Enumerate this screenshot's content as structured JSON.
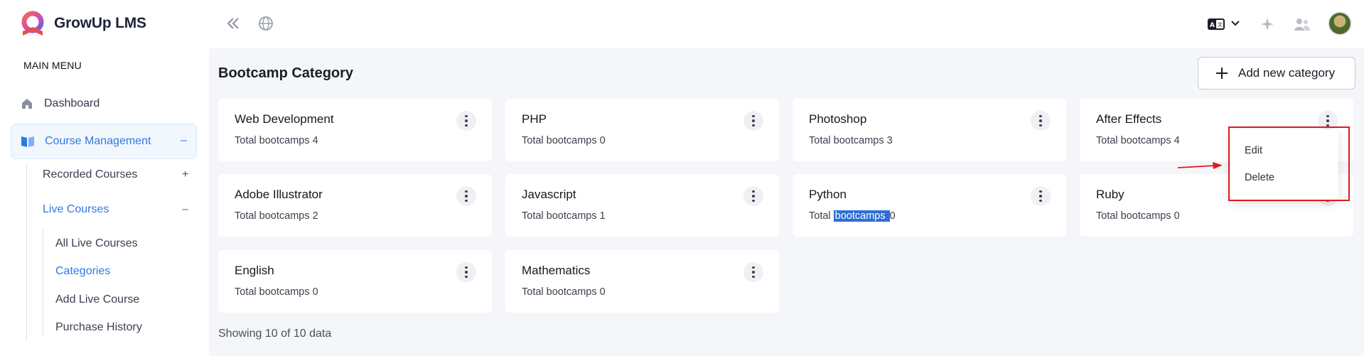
{
  "app": {
    "name": "GrowUp LMS"
  },
  "sidebar": {
    "menu_label": "MAIN MENU",
    "dashboard": "Dashboard",
    "course_management": "Course Management",
    "course_management_sign": "–",
    "recorded_courses": "Recorded Courses",
    "recorded_sign": "+",
    "live_courses": "Live Courses",
    "live_sign": "–",
    "live_items": [
      "All Live Courses",
      "Categories",
      "Add Live Course",
      "Purchase History"
    ]
  },
  "topbar": {
    "icons": [
      "collapse-icon",
      "globe-icon",
      "language-icon",
      "chevron-down-icon",
      "sparkle-icon",
      "users-icon",
      "avatar"
    ]
  },
  "page": {
    "title": "Bootcamp Category",
    "add_button": "Add new category",
    "footer": "Showing 10 of 10 data"
  },
  "categories": [
    {
      "name": "Web Development",
      "count_label": "Total bootcamps 4"
    },
    {
      "name": "PHP",
      "count_label": "Total bootcamps 0"
    },
    {
      "name": "Photoshop",
      "count_label": "Total bootcamps 3"
    },
    {
      "name": "After Effects",
      "count_label": "Total bootcamps 4"
    },
    {
      "name": "Adobe Illustrator",
      "count_label": "Total bootcamps 2"
    },
    {
      "name": "Javascript",
      "count_label": "Total bootcamps 1"
    },
    {
      "name": "Python",
      "count_prefix": "Total ",
      "count_highlight": "bootcamps ",
      "count_suffix": "0"
    },
    {
      "name": "Ruby",
      "count_label": "Total bootcamps 0"
    },
    {
      "name": "English",
      "count_label": "Total bootcamps 0"
    },
    {
      "name": "Mathematics",
      "count_label": "Total bootcamps 0"
    }
  ],
  "dropdown": {
    "items": [
      "Edit",
      "Delete"
    ]
  },
  "colors": {
    "accent": "#2f7ae0",
    "highlight": "#2e6fd6",
    "annotation": "#e0191f"
  }
}
